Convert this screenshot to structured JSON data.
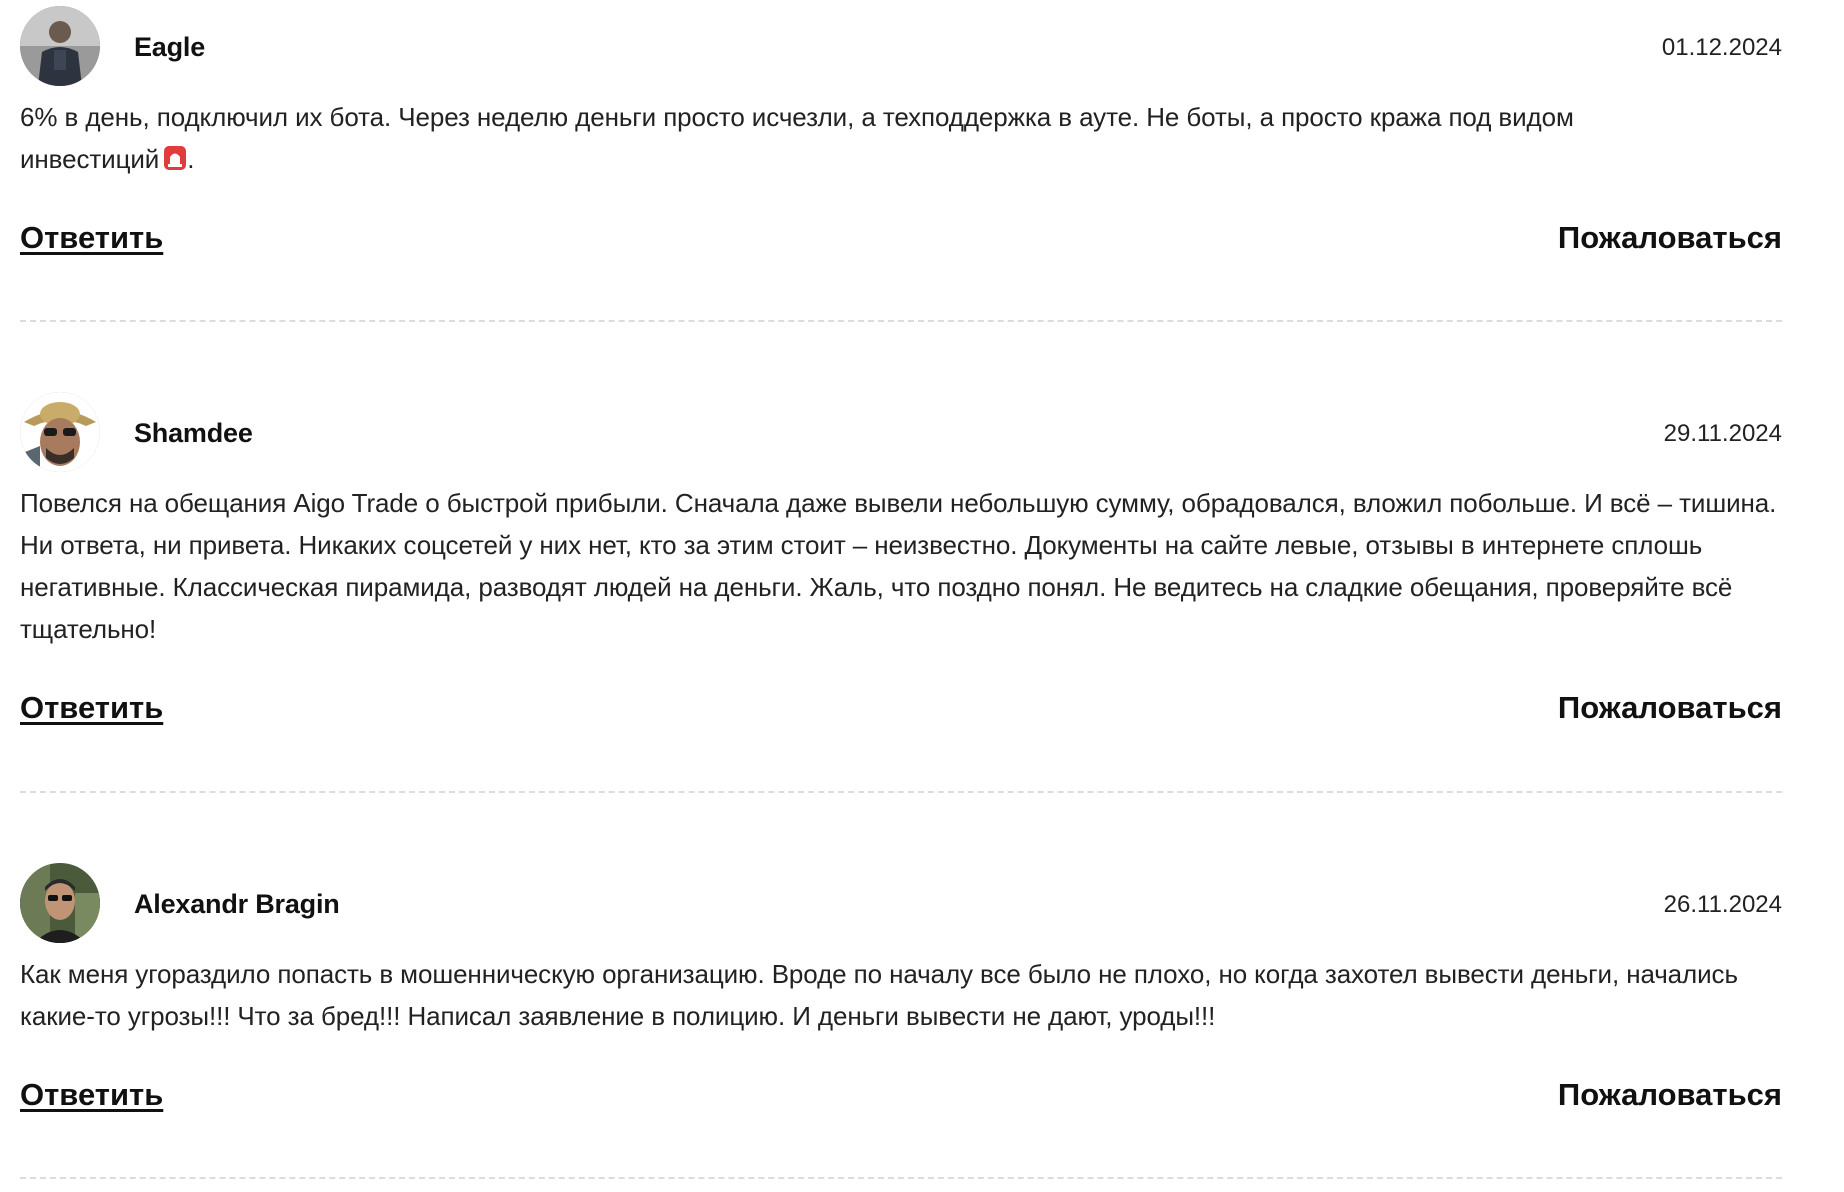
{
  "comments": [
    {
      "author": "Eagle",
      "date": "01.12.2024",
      "text_line1": "6% в день, подключил их бота. Через неделю деньги просто исчезли, а техподдержка в ауте. Не боты, а просто кража под видом",
      "text_line2": "инвестиций",
      "text_end": ".",
      "reply_label": "Ответить",
      "report_label": "Пожаловаться"
    },
    {
      "author": "Shamdee",
      "date": "29.11.2024",
      "text": "Повелся на обещания Aigo Trade о быстрой прибыли. Сначала даже вывели небольшую сумму, обрадовался, вложил побольше. И всё – тишина. Ни ответа, ни привета. Никаких соцсетей у них нет, кто за этим стоит – неизвестно. Документы на сайте левые, отзывы в интернете сплошь негативные. Классическая пирамида, разводят людей на деньги. Жаль, что поздно понял. Не ведитесь на сладкие обещания, проверяйте всё тщательно!",
      "reply_label": "Ответить",
      "report_label": "Пожаловаться"
    },
    {
      "author": "Alexandr Bragin",
      "date": "26.11.2024",
      "text": "Как меня угораздило попасть в мошенническую организацию. Вроде по началу все было не плохо, но когда захотел вывести деньги, начались какие-то угрозы!!! Что за бред!!! Написал заявление в полицию. И деньги вывести не дают, уроды!!!",
      "reply_label": "Ответить",
      "report_label": "Пожаловаться"
    }
  ]
}
